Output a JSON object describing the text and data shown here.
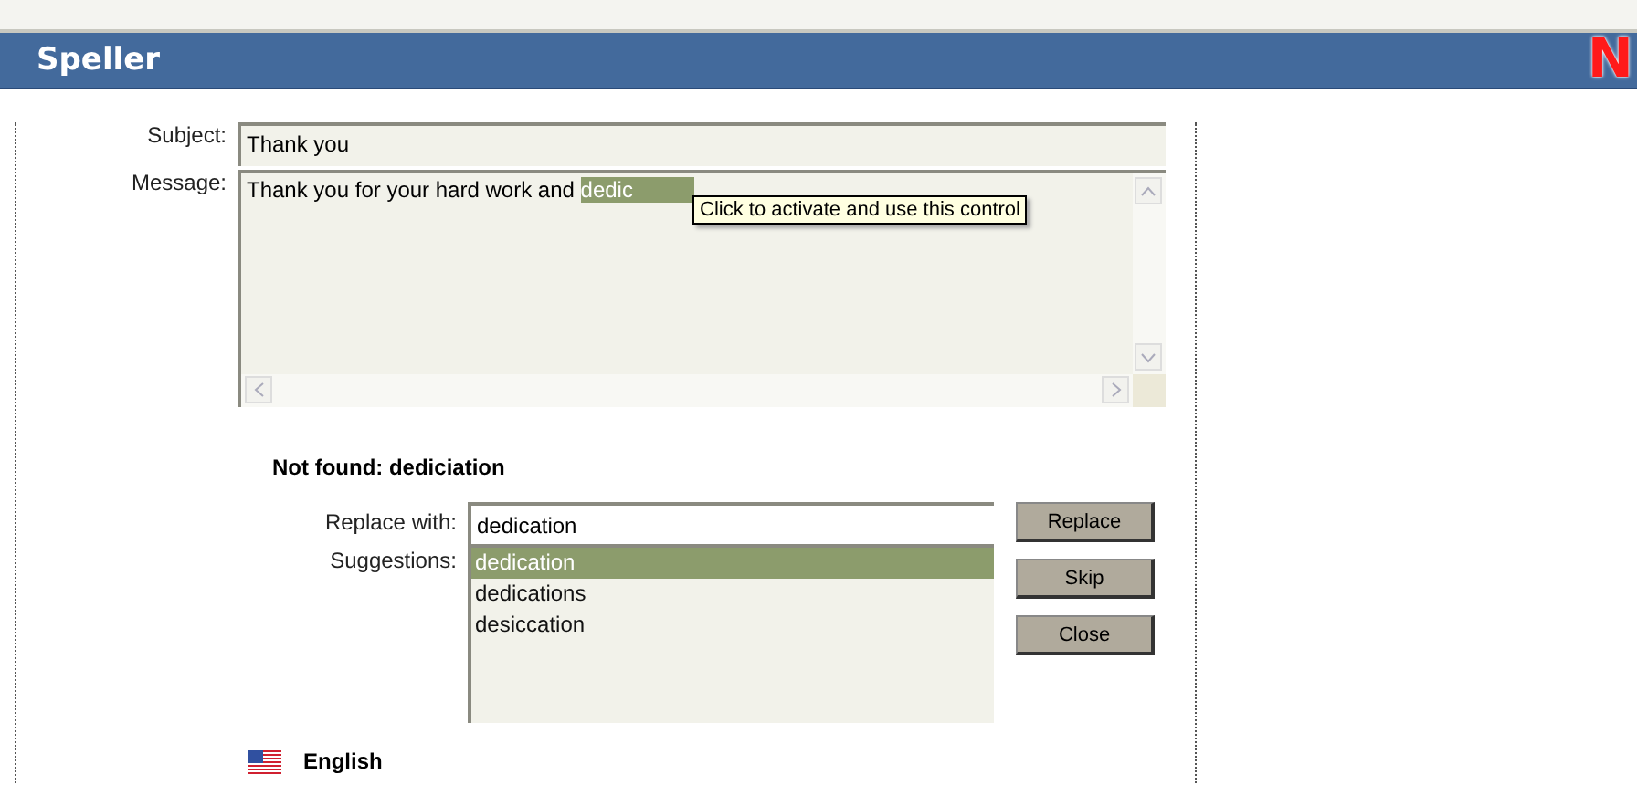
{
  "header": {
    "title": "Speller",
    "logo": "N"
  },
  "subject": {
    "label": "Subject:",
    "value": "Thank you"
  },
  "message": {
    "label": "Message:",
    "text": "Thank you for your hard work and ",
    "highlight": "dedic"
  },
  "tooltip": "Click to activate and use this control",
  "not_found": "Not found: dediciation",
  "replace": {
    "label": "Replace with:",
    "value": "dedication"
  },
  "suggestions": {
    "label": "Suggestions:",
    "items": [
      {
        "text": "dedication",
        "selected": true
      },
      {
        "text": "dedications",
        "selected": false
      },
      {
        "text": "desiccation",
        "selected": false
      }
    ]
  },
  "buttons": [
    "Replace",
    "Skip",
    "Close"
  ],
  "language": "English"
}
